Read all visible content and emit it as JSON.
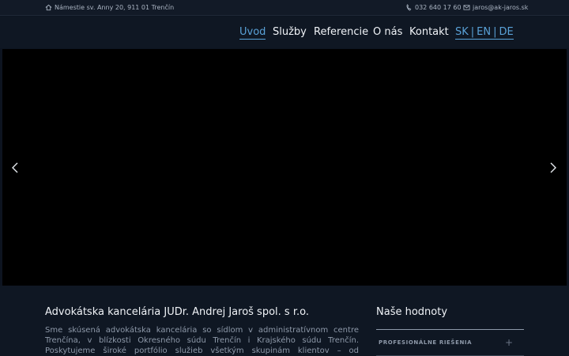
{
  "topbar": {
    "address": "Námestie sv. Anny 20, 911 01 Trenčín",
    "phone": "032 640 17 60",
    "email": "jaros@ak-jaros.sk"
  },
  "nav": {
    "items": [
      {
        "label": "Uvod",
        "active": true
      },
      {
        "label": "Služby"
      },
      {
        "label": "Referencie"
      },
      {
        "label": "O nás"
      },
      {
        "label": "Kontakt"
      }
    ],
    "languages": [
      "SK",
      "EN",
      "DE"
    ],
    "lang_separator": "|"
  },
  "hero": {
    "prev_icon": "chevron-left-icon",
    "next_icon": "chevron-right-icon"
  },
  "about": {
    "title": "Advokátska kancelária JUDr. Andrej Jaroš spol. s r.o.",
    "text": "Sme skúsená advokátska kancelária so sídlom v administratívnom centre Trenčína, v blízkosti Okresného súdu Trenčín i Krajského súdu Trenčín. Poskytujeme široké portfólio služieb všetkým skupinám klientov – od individuálnych osôb po"
  },
  "values": {
    "title": "Naše hodnoty",
    "items": [
      {
        "label": "PROFESIONÁLNE RIEŠENIA"
      }
    ]
  },
  "colors": {
    "background": "#0d1420",
    "accent": "#5aa2d8",
    "hero": "#000000"
  }
}
